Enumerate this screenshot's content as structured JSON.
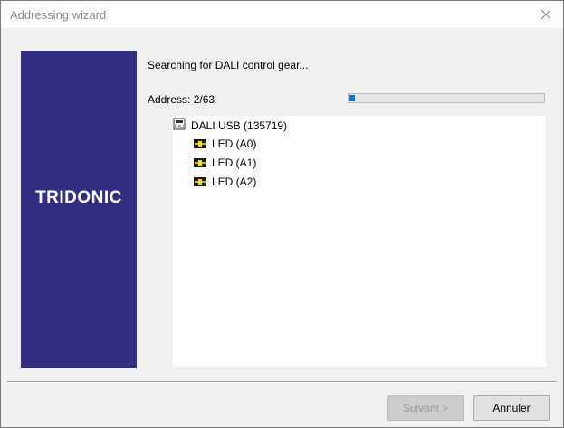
{
  "window": {
    "title": "Addressing wizard",
    "close_icon": "close-icon"
  },
  "banner": {
    "brand": "TRIDONIC",
    "color": "#332f80"
  },
  "status": {
    "message": "Searching for DALI control gear...",
    "address_label": "Address: 2/63",
    "progress": 0.03,
    "progress_color": "#0078d7"
  },
  "tree": {
    "root": {
      "label": "DALI USB (135719)",
      "icon": "dali-usb-icon"
    },
    "children": [
      {
        "label": "LED (A0)",
        "icon": "led-icon"
      },
      {
        "label": "LED (A1)",
        "icon": "led-icon"
      },
      {
        "label": "LED (A2)",
        "icon": "led-icon"
      }
    ]
  },
  "buttons": {
    "next": "Suivant >",
    "cancel": "Annuler"
  }
}
